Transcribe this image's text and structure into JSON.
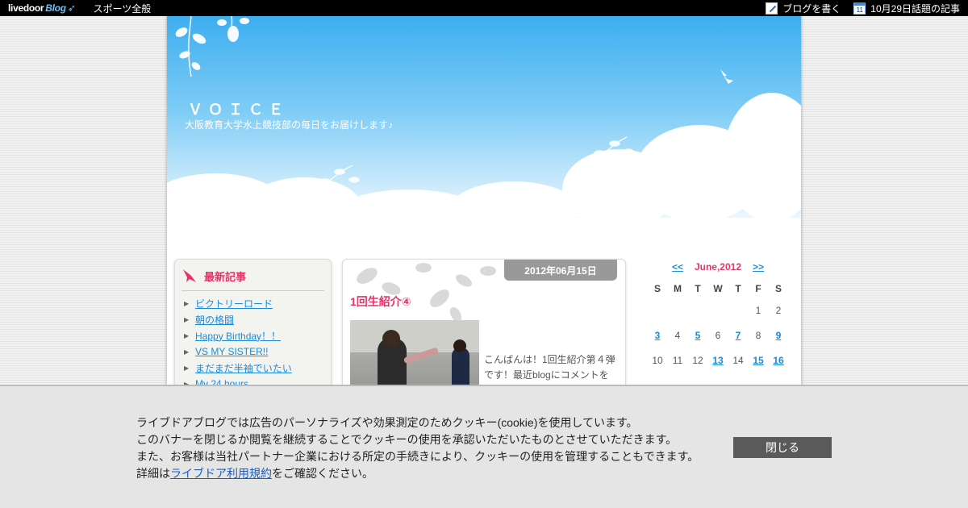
{
  "topbar": {
    "logo_text": "livedoor",
    "logo_blog": "Blog",
    "category": "スポーツ全般",
    "write_label": "ブログを書く",
    "topic_calendar_day": "11",
    "topic_label": "10月29日話題の記事"
  },
  "blog": {
    "title": "ＶＯＩＣＥ",
    "description": "大阪教育大学水上競技部の毎日をお届けします♪"
  },
  "sidebar": {
    "heading": "最新記事",
    "items": [
      {
        "label": "ビクトリーロード"
      },
      {
        "label": "朝の格闘"
      },
      {
        "label": "Happy Birthday！！"
      },
      {
        "label": "VS MY SISTER!!"
      },
      {
        "label": "まだまだ半袖でいたい"
      },
      {
        "label": "My 24 hours"
      }
    ]
  },
  "entry": {
    "date": "2012年06月15日",
    "title": "1回生紹介④",
    "body": "こんばんは！1回生紹介第４弾です！最近blogにコメントを"
  },
  "calendar": {
    "prev": "<<",
    "month": "June,2012",
    "next": ">>",
    "weekdays": [
      "S",
      "M",
      "T",
      "W",
      "T",
      "F",
      "S"
    ],
    "days": [
      {
        "d": "",
        "link": false
      },
      {
        "d": "",
        "link": false
      },
      {
        "d": "",
        "link": false
      },
      {
        "d": "",
        "link": false
      },
      {
        "d": "",
        "link": false
      },
      {
        "d": "1",
        "link": false
      },
      {
        "d": "2",
        "link": false
      },
      {
        "d": "3",
        "link": true
      },
      {
        "d": "4",
        "link": false
      },
      {
        "d": "5",
        "link": true
      },
      {
        "d": "6",
        "link": false
      },
      {
        "d": "7",
        "link": true
      },
      {
        "d": "8",
        "link": false
      },
      {
        "d": "9",
        "link": true
      },
      {
        "d": "10",
        "link": false
      },
      {
        "d": "11",
        "link": false
      },
      {
        "d": "12",
        "link": false
      },
      {
        "d": "13",
        "link": true
      },
      {
        "d": "14",
        "link": false
      },
      {
        "d": "15",
        "link": true
      },
      {
        "d": "16",
        "link": true
      }
    ]
  },
  "cookie": {
    "line1": "ライブドアブログでは広告のパーソナライズや効果測定のためクッキー(cookie)を使用しています。",
    "line2": "このバナーを閉じるか閲覧を継続することでクッキーの使用を承認いただいたものとさせていただきます。",
    "line3": "また、お客様は当社パートナー企業における所定の手続きにより、クッキーの使用を管理することもできます。",
    "line4_prefix": "詳細は",
    "line4_link": "ライブドア利用規約",
    "line4_suffix": "をご確認ください。",
    "close_label": "閉じる"
  }
}
